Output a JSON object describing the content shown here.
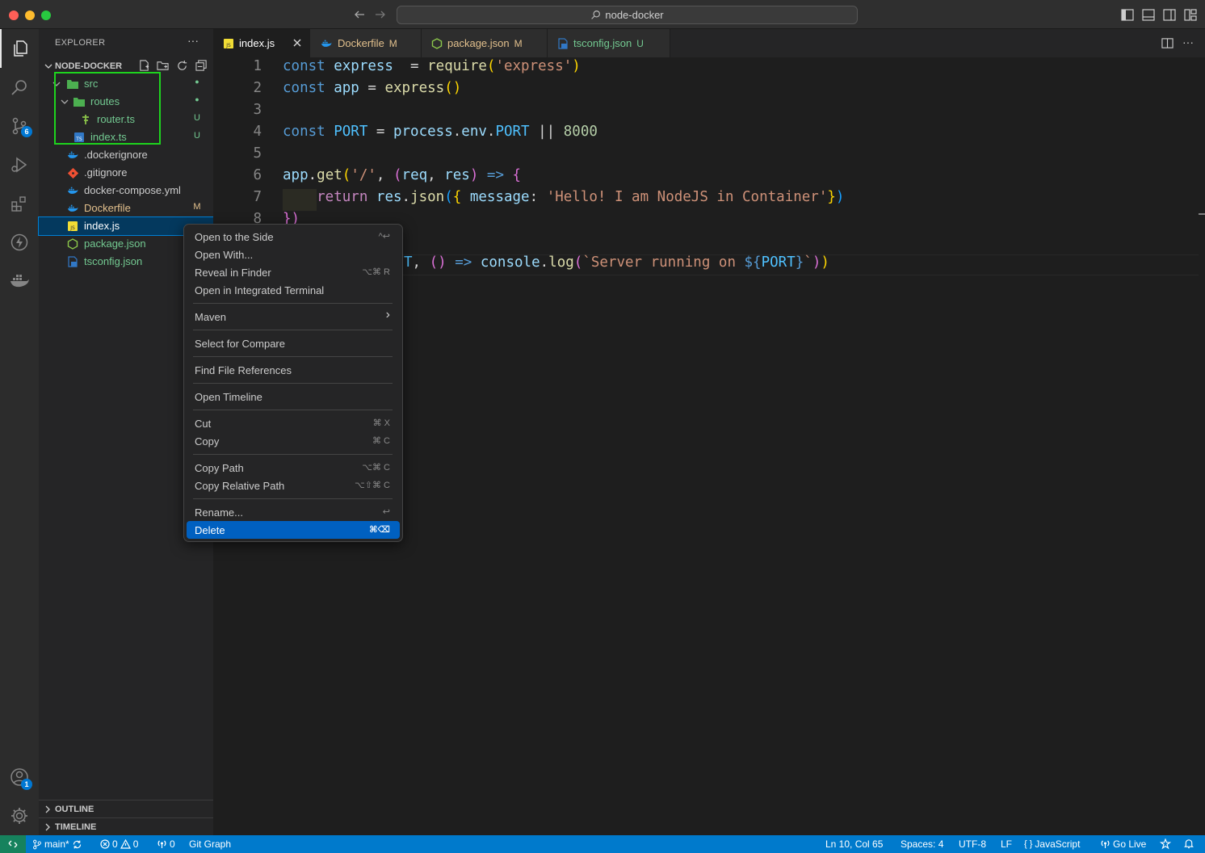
{
  "window": {
    "title": "node-docker"
  },
  "colors": {
    "accent": "#007acc",
    "selection": "#0060c0",
    "git_untracked": "#73c991",
    "git_modified": "#e2c08d",
    "highlight_box": "#1ed41e"
  },
  "activity_bar": {
    "items": [
      {
        "name": "explorer-icon"
      },
      {
        "name": "search-icon"
      },
      {
        "name": "source-control-icon",
        "badge": "6"
      },
      {
        "name": "run-debug-icon"
      },
      {
        "name": "extensions-icon"
      },
      {
        "name": "lightning-icon"
      },
      {
        "name": "docker-icon"
      }
    ],
    "accounts_badge": "1"
  },
  "sidebar": {
    "title": "EXPLORER",
    "more": "···",
    "project": "NODE-DOCKER",
    "tree": [
      {
        "label": "src",
        "decoration": "●"
      },
      {
        "label": "routes",
        "decoration": "●"
      },
      {
        "label": "router.ts",
        "decoration": "U"
      },
      {
        "label": "index.ts",
        "decoration": "U"
      },
      {
        "label": ".dockerignore",
        "decoration": ""
      },
      {
        "label": ".gitignore",
        "decoration": ""
      },
      {
        "label": "docker-compose.yml",
        "decoration": ""
      },
      {
        "label": "Dockerfile",
        "decoration": "M"
      },
      {
        "label": "index.js",
        "decoration": ""
      },
      {
        "label": "package.json",
        "decoration": ""
      },
      {
        "label": "tsconfig.json",
        "decoration": ""
      }
    ],
    "outline": "OUTLINE",
    "timeline": "TIMELINE"
  },
  "tabs": [
    {
      "label": "index.js",
      "decoration": ""
    },
    {
      "label": "Dockerfile",
      "decoration": "M"
    },
    {
      "label": "package.json",
      "decoration": "M"
    },
    {
      "label": "tsconfig.json",
      "decoration": "U"
    }
  ],
  "editor": {
    "line_numbers": [
      "1",
      "2",
      "3",
      "4",
      "5",
      "6",
      "7",
      "8"
    ],
    "lines": [
      [
        [
          "kw",
          "const "
        ],
        [
          "vr",
          "express"
        ],
        [
          "",
          "  = "
        ],
        [
          "fn",
          "require"
        ],
        [
          "br1",
          "("
        ],
        [
          "st",
          "'express'"
        ],
        [
          "br1",
          ")"
        ]
      ],
      [
        [
          "kw",
          "const "
        ],
        [
          "vr",
          "app"
        ],
        [
          "",
          " = "
        ],
        [
          "fn",
          "express"
        ],
        [
          "br1",
          "()"
        ]
      ],
      [],
      [
        [
          "kw",
          "const "
        ],
        [
          "cst",
          "PORT"
        ],
        [
          "",
          " = "
        ],
        [
          "vr",
          "process"
        ],
        [
          "",
          "."
        ],
        [
          "vr",
          "env"
        ],
        [
          "",
          "."
        ],
        [
          "cst",
          "PORT"
        ],
        [
          "",
          " || "
        ],
        [
          "nm",
          "8000"
        ]
      ],
      [],
      [
        [
          "vr",
          "app"
        ],
        [
          "",
          "."
        ],
        [
          "fn",
          "get"
        ],
        [
          "br1",
          "("
        ],
        [
          "st",
          "'/'"
        ],
        [
          "",
          ", "
        ],
        [
          "br2",
          "("
        ],
        [
          "vr",
          "req"
        ],
        [
          "",
          ", "
        ],
        [
          "vr",
          "res"
        ],
        [
          "br2",
          ")"
        ],
        [
          "kw",
          " => "
        ],
        [
          "br2",
          "{"
        ]
      ],
      [
        [
          "",
          ""
        ],
        [
          "kw2",
          "    return "
        ],
        [
          "vr",
          "res"
        ],
        [
          "",
          "."
        ],
        [
          "fn",
          "json"
        ],
        [
          "br3",
          "("
        ],
        [
          "br1",
          "{ "
        ],
        [
          "vr",
          "message"
        ],
        [
          "",
          ": "
        ],
        [
          "st",
          "'Hello! I am NodeJS in Container'"
        ],
        [
          "br1",
          "}"
        ],
        [
          "br3",
          ")"
        ]
      ],
      [
        [
          "br2",
          "})"
        ]
      ],
      [],
      [
        [
          "cst",
          "T"
        ],
        [
          "",
          ", "
        ],
        [
          "br2",
          "()"
        ],
        [
          "kw",
          " => "
        ],
        [
          "vr",
          "console"
        ],
        [
          "",
          "."
        ],
        [
          "fn",
          "log"
        ],
        [
          "br2",
          "("
        ],
        [
          "st",
          "`Server running on "
        ],
        [
          "kw",
          "${"
        ],
        [
          "cst",
          "PORT"
        ],
        [
          "kw",
          "}"
        ],
        [
          "st",
          "`"
        ],
        [
          "br2",
          ")"
        ],
        [
          "br1",
          ")"
        ]
      ]
    ]
  },
  "context_menu": {
    "items": [
      {
        "label": "Open to the Side",
        "shortcut": "^↩"
      },
      {
        "label": "Open With...",
        "shortcut": ""
      },
      {
        "label": "Reveal in Finder",
        "shortcut": "⌥⌘ R"
      },
      {
        "label": "Open in Integrated Terminal",
        "shortcut": ""
      },
      {
        "label": "Maven",
        "shortcut": "›"
      },
      {
        "label": "Select for Compare",
        "shortcut": ""
      },
      {
        "label": "Find File References",
        "shortcut": ""
      },
      {
        "label": "Open Timeline",
        "shortcut": ""
      },
      {
        "label": "Cut",
        "shortcut": "⌘ X"
      },
      {
        "label": "Copy",
        "shortcut": "⌘ C"
      },
      {
        "label": "Copy Path",
        "shortcut": "⌥⌘ C"
      },
      {
        "label": "Copy Relative Path",
        "shortcut": "⌥⇧⌘ C"
      },
      {
        "label": "Rename...",
        "shortcut": "↩"
      },
      {
        "label": "Delete",
        "shortcut": "⌘⌫"
      }
    ]
  },
  "status_bar": {
    "branch": "main*",
    "errors": "0",
    "warnings": "0",
    "ports": "0",
    "git_graph": "Git Graph",
    "position": "Ln 10, Col 65",
    "spaces": "Spaces: 4",
    "encoding": "UTF-8",
    "eol": "LF",
    "language": "JavaScript",
    "go_live": "Go Live"
  }
}
